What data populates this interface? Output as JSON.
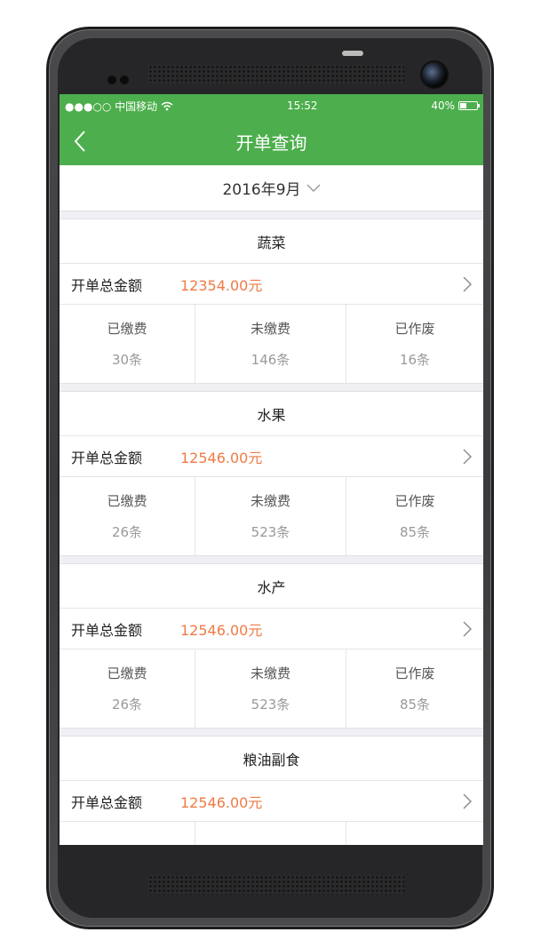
{
  "status": {
    "carrier": "●●●○○ 中国移动",
    "time": "15:52",
    "battery": "40%",
    "battery_level": 0.4
  },
  "nav": {
    "title": "开单查询"
  },
  "filter": {
    "month": "2016年9月"
  },
  "colors": {
    "primary": "#4cae4c",
    "amount": "#ef7a45"
  },
  "sections": [
    {
      "title": "蔬菜",
      "total_label": "开单总金额",
      "total_value": "12354.00元",
      "stats": [
        {
          "label": "已缴费",
          "value": "30条"
        },
        {
          "label": "未缴费",
          "value": "146条"
        },
        {
          "label": "已作废",
          "value": "16条"
        }
      ]
    },
    {
      "title": "水果",
      "total_label": "开单总金额",
      "total_value": "12546.00元",
      "stats": [
        {
          "label": "已缴费",
          "value": "26条"
        },
        {
          "label": "未缴费",
          "value": "523条"
        },
        {
          "label": "已作废",
          "value": "85条"
        }
      ]
    },
    {
      "title": "水产",
      "total_label": "开单总金额",
      "total_value": "12546.00元",
      "stats": [
        {
          "label": "已缴费",
          "value": "26条"
        },
        {
          "label": "未缴费",
          "value": "523条"
        },
        {
          "label": "已作废",
          "value": "85条"
        }
      ]
    },
    {
      "title": "粮油副食",
      "total_label": "开单总金额",
      "total_value": "12546.00元",
      "stats": []
    }
  ]
}
